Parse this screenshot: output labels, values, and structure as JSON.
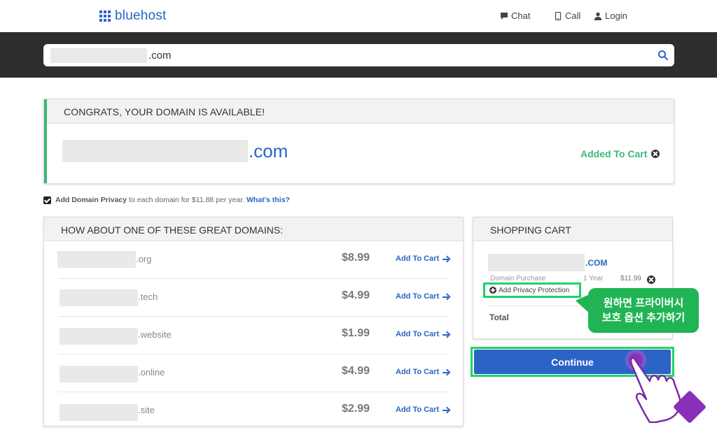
{
  "header": {
    "logo_text": "bluehost",
    "nav": {
      "chat": "Chat",
      "call": "Call",
      "login": "Login"
    }
  },
  "search": {
    "value_suffix": ".com"
  },
  "congrats": {
    "title": "CONGRATS, YOUR DOMAIN IS AVAILABLE!",
    "domain_tld": ".com",
    "status": "Added To Cart"
  },
  "privacy": {
    "bold_label": "Add Domain Privacy",
    "text": "to each domain for $11.88 per year.",
    "link": "What's this?",
    "checked": true
  },
  "suggestions": {
    "title": "HOW ABOUT ONE OF THESE GREAT DOMAINS:",
    "rows": [
      {
        "tld": ".org",
        "price": "$8.99",
        "action": "Add To Cart"
      },
      {
        "tld": ".tech",
        "price": "$4.99",
        "action": "Add To Cart"
      },
      {
        "tld": ".website",
        "price": "$1.99",
        "action": "Add To Cart"
      },
      {
        "tld": ".online",
        "price": "$4.99",
        "action": "Add To Cart"
      },
      {
        "tld": ".site",
        "price": "$2.99",
        "action": "Add To Cart"
      }
    ]
  },
  "cart": {
    "title": "SHOPPING CART",
    "domain_tld": ".COM",
    "purchase_label": "Domain Purchase",
    "term": "1 Year",
    "price": "$11.99",
    "add_privacy": "Add Privacy Protection",
    "total_label": "Total",
    "continue_label": "Continue"
  },
  "annotation": {
    "text": "원하면 프라이버시\n보호 옵션 추가하기",
    "color": "#20b454"
  },
  "colors": {
    "brand": "#2b64c6",
    "success": "#3cb878",
    "highlight": "#20d26a"
  }
}
